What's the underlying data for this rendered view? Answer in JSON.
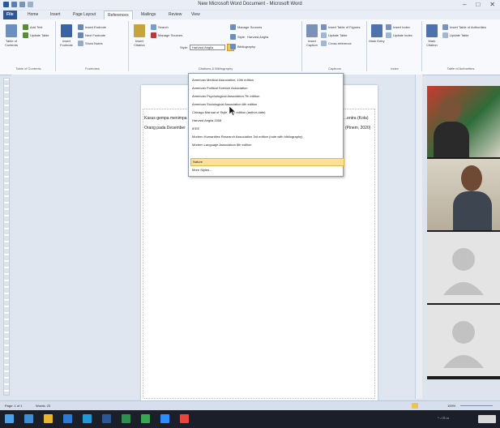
{
  "app": {
    "title": "New Microsoft Word Document - Microsoft Word",
    "window_controls": [
      "–",
      "□",
      "✕"
    ]
  },
  "tabs": [
    {
      "label": "File"
    },
    {
      "label": "Home"
    },
    {
      "label": "Insert"
    },
    {
      "label": "Page Layout"
    },
    {
      "label": "References"
    },
    {
      "label": "Mailings"
    },
    {
      "label": "Review"
    },
    {
      "label": "View"
    }
  ],
  "ribbon": {
    "toc": {
      "big_label": "Table of Contents",
      "add_text": "Add Text",
      "update_table": "Update Table",
      "group": "Table of Contents"
    },
    "footnotes": {
      "insert_footnote": "Insert Footnote",
      "insert_endnote": "Insert Endnote",
      "next_footnote": "Next Footnote",
      "show_notes": "Show Notes",
      "big_label": "Insert Footnote",
      "group": "Footnotes"
    },
    "citations": {
      "insert_citation": "Insert Citation",
      "manage_sources": "Manage Sources",
      "style_label": "Style:",
      "style_value": "Harvard Anglia",
      "bibliography": "Bibliography",
      "group": "Citations & Bibliography",
      "search": "Search"
    },
    "captions": {
      "insert_caption": "Insert Caption",
      "insert_tof": "Insert Table of Figures",
      "update_table": "Update Table",
      "cross_reference": "Cross-reference",
      "group": "Captions"
    },
    "index": {
      "mark_entry": "Mark Entry",
      "insert_index": "Insert Index",
      "update_index": "Update Index",
      "group": "Index"
    },
    "toa": {
      "mark_citation": "Mark Citation",
      "insert_toa": "Insert Table of Authorities",
      "update_table": "Update Table",
      "group": "Table of Authorities"
    }
  },
  "style_dropdown": {
    "options": [
      "American Medical Association, 10th edition",
      "American Political Science Association",
      "American Psychological Association 7th edition",
      "American Sociological Association 6th edition",
      "Chicago Manual of Style, 17th edition (author-date)",
      "Harvard Anglia 2008",
      "IEEE",
      "Modern Humanities Research Association 3rd edition (note with bibliography)",
      "Modern Language Association 8th edition",
      "Nature",
      "More Styles..."
    ],
    "selected_index": 9
  },
  "document": {
    "line1_left": "Kasus gempa menimpa",
    "line1_right": "...entra (Kota)",
    "line2_left": "Orang pada Desember",
    "line2_right": "(Pinem, 2020)"
  },
  "status": {
    "page": "Page: 1 of 1",
    "words": "Words: 23",
    "zoom": "100%"
  },
  "colors": {
    "accent": "#2b5797",
    "highlight": "#fbe09a",
    "taskbar": "#1b1f2a"
  }
}
